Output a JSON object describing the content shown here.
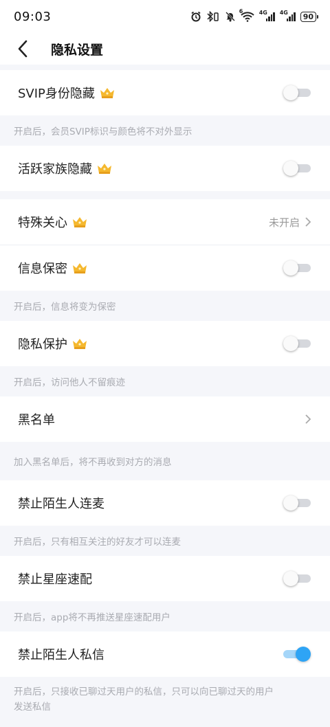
{
  "status": {
    "time": "09:03",
    "battery": "90",
    "net1": "4G",
    "net2": "4G",
    "wifi_label": "6"
  },
  "nav": {
    "title": "隐私设置"
  },
  "colors": {
    "accent": "#2ea4f5",
    "crown": "#f5b82e",
    "hint": "#a9abb1"
  },
  "items": {
    "svip_hide": {
      "label": "SVIP身份隐藏",
      "toggle": false,
      "hint": "开启后，会员SVIP标识与颜色将不对外显示"
    },
    "family_hide": {
      "label": "活跃家族隐藏",
      "toggle": false
    },
    "special_care": {
      "label": "特殊关心",
      "value": "未开启"
    },
    "info_secret": {
      "label": "信息保密",
      "toggle": false,
      "hint": "开启后，信息将变为保密"
    },
    "privacy_protect": {
      "label": "隐私保护",
      "toggle": false,
      "hint": "开启后，访问他人不留痕迹"
    },
    "blacklist": {
      "label": "黑名单",
      "hint": "加入黑名单后，将不再收到对方的消息"
    },
    "no_stranger_mic": {
      "label": "禁止陌生人连麦",
      "toggle": false,
      "hint": "开启后，只有相互关注的好友才可以连麦"
    },
    "no_star_match": {
      "label": "禁止星座速配",
      "toggle": false,
      "hint": "开启后，app将不再推送星座速配用户"
    },
    "no_stranger_msg": {
      "label": "禁止陌生人私信",
      "toggle": true,
      "hint_line1": "开启后，只接收已聊过天用户的私信，只可以向已聊过天的用户",
      "hint_line2": "发送私信"
    }
  }
}
